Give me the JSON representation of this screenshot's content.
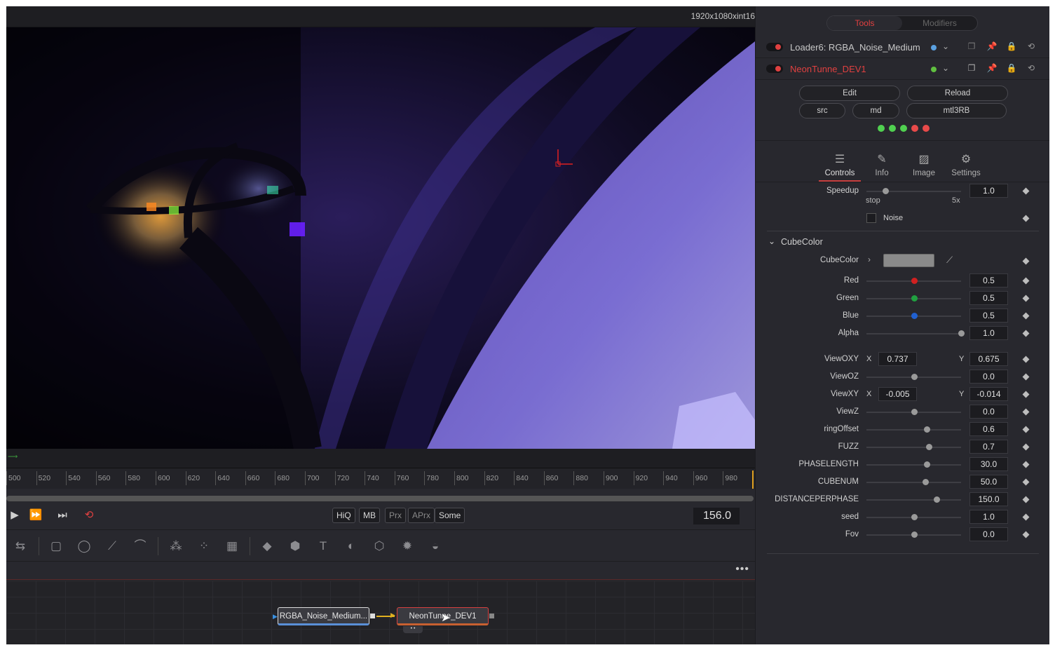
{
  "viewer": {
    "resolution": "1920x1080xint16"
  },
  "ruler": {
    "ticks": [
      "500",
      "520",
      "540",
      "560",
      "580",
      "600",
      "620",
      "640",
      "660",
      "680",
      "700",
      "720",
      "740",
      "760",
      "780",
      "800",
      "820",
      "840",
      "860",
      "880",
      "900",
      "920",
      "940",
      "960",
      "980"
    ]
  },
  "transport": {
    "hiq": "HiQ",
    "mb": "MB",
    "prx": "Prx",
    "aprx": "APrx",
    "some": "Some",
    "frame": "156.0"
  },
  "nodes": {
    "loader": "RGBA_Noise_Medium...",
    "neon": "NeonTunne_DEV1"
  },
  "panel": {
    "tabs": {
      "tools": "Tools",
      "modifiers": "Modifiers"
    },
    "tool1": "Loader6: RGBA_Noise_Medium",
    "tool2": "NeonTunne_DEV1",
    "buttons": {
      "edit": "Edit",
      "reload": "Reload",
      "src": "src",
      "md": "md",
      "mtl": "mtl3RB"
    },
    "ctabs": {
      "controls": "Controls",
      "info": "Info",
      "image": "Image",
      "settings": "Settings"
    },
    "speedup": {
      "label": "Speedup",
      "value": "1.0",
      "min": "stop",
      "max": "5x",
      "level": 0.2
    },
    "noise": "Noise",
    "section": "CubeColor",
    "cubecolor": "CubeColor",
    "red": {
      "label": "Red",
      "value": "0.5"
    },
    "green": {
      "label": "Green",
      "value": "0.5"
    },
    "blue": {
      "label": "Blue",
      "value": "0.5"
    },
    "alpha": {
      "label": "Alpha",
      "value": "1.0"
    },
    "viewoxy": {
      "label": "ViewOXY",
      "x": "0.737",
      "y": "0.675"
    },
    "viewoz": {
      "label": "ViewOZ",
      "value": "0.0"
    },
    "viewxy": {
      "label": "ViewXY",
      "x": "-0.005",
      "y": "-0.014"
    },
    "viewz": {
      "label": "ViewZ",
      "value": "0.0"
    },
    "ringoffset": {
      "label": "ringOffset",
      "value": "0.6"
    },
    "fuzz": {
      "label": "FUZZ",
      "value": "0.7"
    },
    "phaselength": {
      "label": "PHASELENGTH",
      "value": "30.0"
    },
    "cubenum": {
      "label": "CUBENUM",
      "value": "50.0"
    },
    "distance": {
      "label": "DISTANCEPERPHASE",
      "value": "150.0"
    },
    "seed": {
      "label": "seed",
      "value": "1.0"
    },
    "fov": {
      "label": "Fov",
      "value": "0.0"
    },
    "xlabel": "X",
    "ylabel": "Y"
  },
  "colors": {
    "accent": "#e04040",
    "loaderDot": "#5aa0e0",
    "neonDot": "#60c040"
  }
}
